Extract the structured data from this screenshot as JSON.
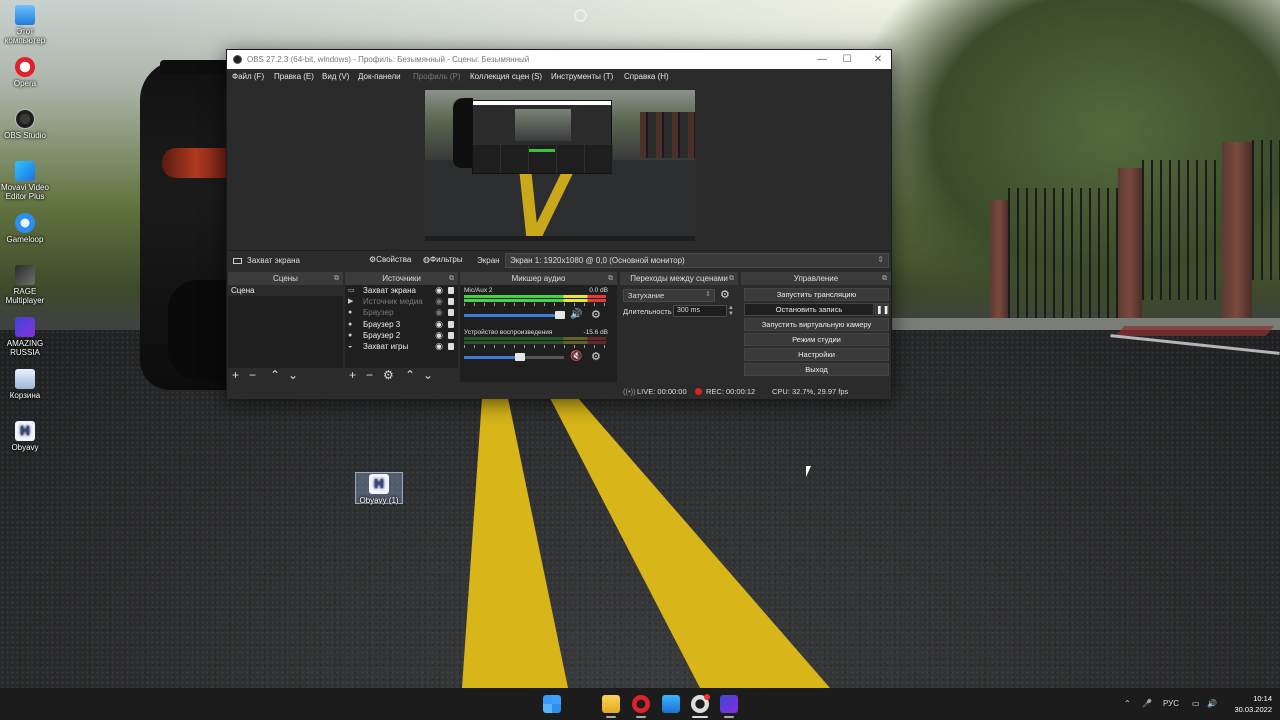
{
  "desktop": {
    "icons": [
      {
        "label": "Этот компьютер"
      },
      {
        "label": "Opera"
      },
      {
        "label": "OBS Studio"
      },
      {
        "label": "Movavi Video Editor Plus"
      },
      {
        "label": "Gameloop"
      },
      {
        "label": "RAGE Multiplayer"
      },
      {
        "label": "AMAZING RUSSIA"
      },
      {
        "label": "Корзина"
      },
      {
        "label": "Obyavy"
      },
      {
        "label": "Obyavy (1)"
      }
    ],
    "doc_glyph": "H"
  },
  "obs": {
    "title": "OBS 27.2.3 (64-bit, windows) - Профиль: Безымянный - Сцены: Безымянный",
    "window_buttons": {
      "minimize": "—",
      "maximize": "☐",
      "close": "✕"
    },
    "menu": [
      "Файл (F)",
      "Правка (E)",
      "Вид (V)",
      "Док-панели",
      "Профиль (P)",
      "Коллекция сцен (S)",
      "Инструменты (T)",
      "Справка (H)"
    ],
    "source_bar": {
      "selected_source": "Захват экрана",
      "properties": "Свойства",
      "filters": "Фильтры",
      "screen_label": "Экран",
      "screen_value": "Экран 1: 1920x1080 @ 0,0 (Основной монитор)"
    },
    "scenes": {
      "title": "Сцены",
      "items": [
        "Сцена"
      ]
    },
    "sources": {
      "title": "Источники",
      "items": [
        {
          "label": "Захват экрана",
          "visible": true
        },
        {
          "label": "Источник медиа",
          "visible": false
        },
        {
          "label": "Браузер",
          "visible": false
        },
        {
          "label": "Браузер 3",
          "visible": true
        },
        {
          "label": "Браузер 2",
          "visible": true
        },
        {
          "label": "Захват игры",
          "visible": true
        }
      ]
    },
    "mixer": {
      "title": "Микшер аудио",
      "channels": [
        {
          "name": "Mic/Aux 2",
          "db": "0.0 dB",
          "level": 1.0,
          "volume": 0.96,
          "muted": false
        },
        {
          "name": "Устройство воспроизведения",
          "db": "-15.6 dB",
          "level": 0.0,
          "volume": 0.56,
          "muted": true
        }
      ]
    },
    "transitions": {
      "title": "Переходы между сценами",
      "type": "Затухание",
      "duration_label": "Длительность",
      "duration_value": "300 ms"
    },
    "controls": {
      "title": "Управление",
      "buttons": [
        "Запустить трансляцию",
        "Остановить запись",
        "Запустить виртуальную камеру",
        "Режим студии",
        "Настройки",
        "Выход"
      ]
    },
    "status": {
      "live": "LIVE: 00:00:00",
      "rec": "REC: 00:00:12",
      "cpu": "CPU: 32.7%, 29.97 fps"
    }
  },
  "taskbar": {
    "tray_lang": "РУС",
    "time": "10:14",
    "date": "30.03.2022"
  }
}
